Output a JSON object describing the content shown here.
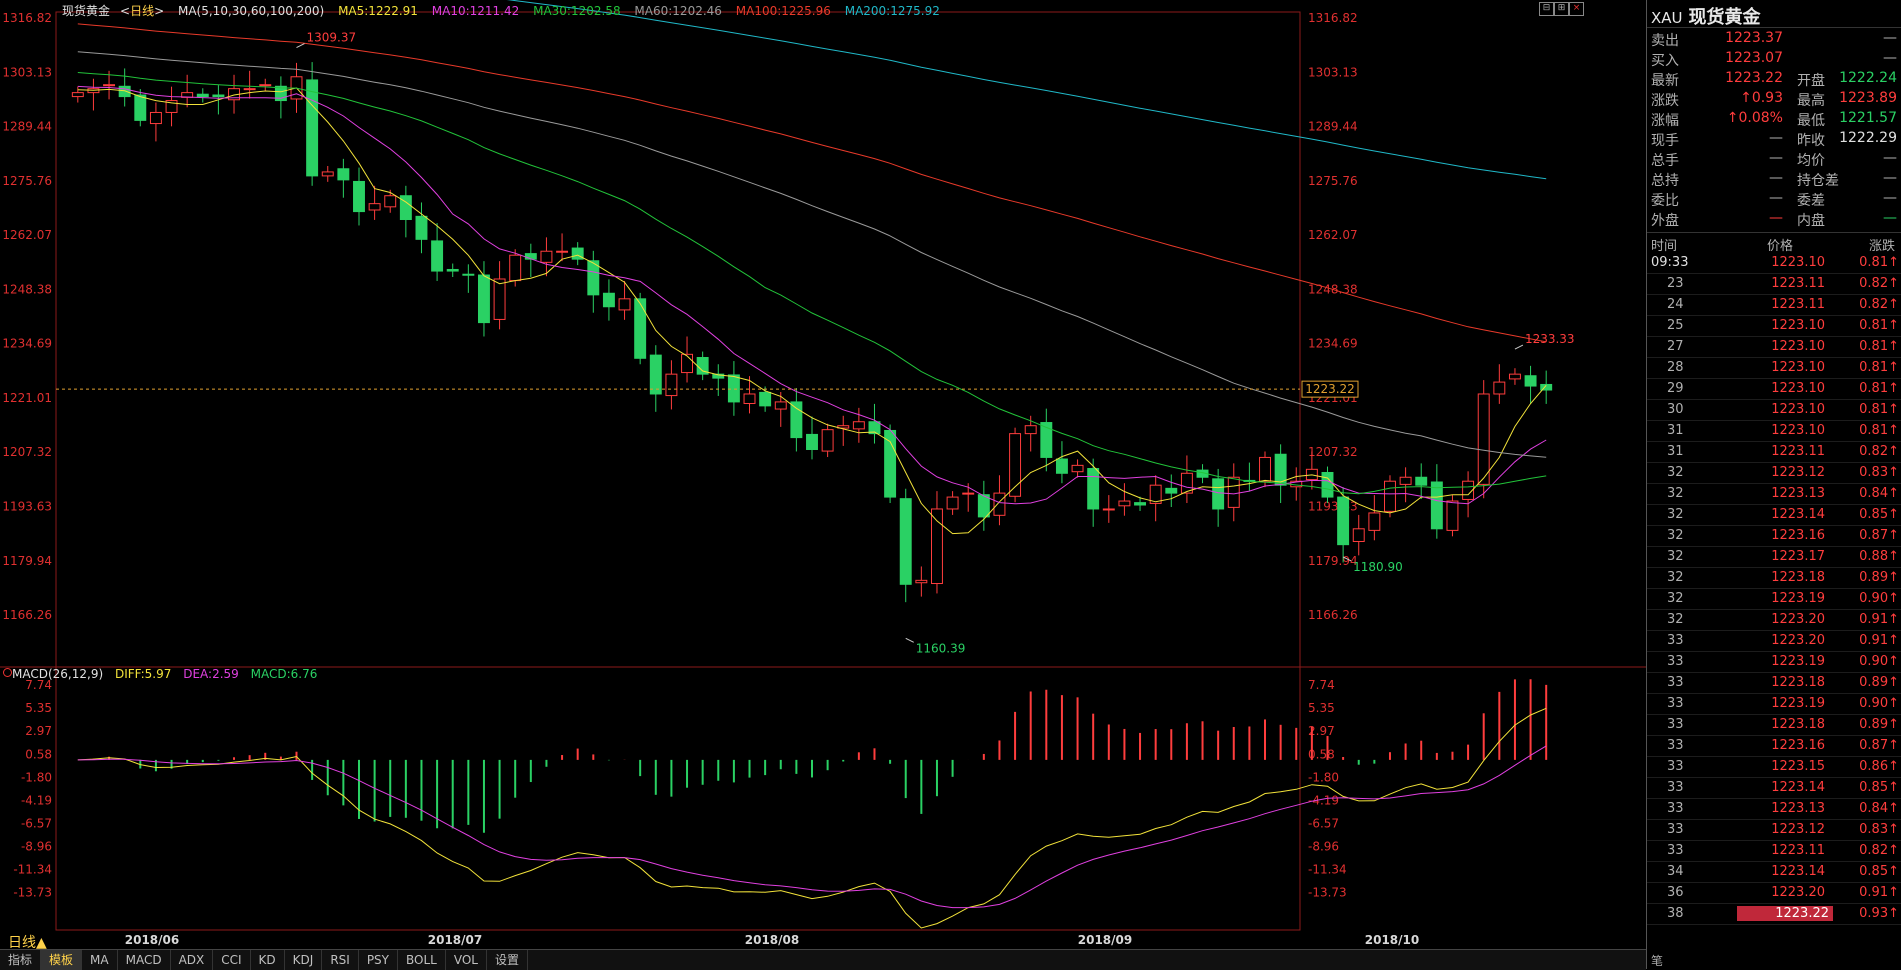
{
  "instrument": {
    "name": "现货黄金",
    "period": "日线",
    "code": "XAU"
  },
  "ma_legend": {
    "params": "MA(5,10,30,60,100,200)",
    "items": [
      {
        "label": "MA5:1222.91",
        "color": "#f2e23a"
      },
      {
        "label": "MA10:1211.42",
        "color": "#e040e0"
      },
      {
        "label": "MA30:1202.58",
        "color": "#22c33a"
      },
      {
        "label": "MA60:1202.46",
        "color": "#9a9a9a"
      },
      {
        "label": "MA100:1225.96",
        "color": "#e83a2a"
      },
      {
        "label": "MA200:1275.92",
        "color": "#20b8c8"
      }
    ]
  },
  "macd_legend": {
    "params": "MACD(26,12,9)",
    "diff": "DIFF:5.97",
    "dea": "DEA:2.59",
    "macd": "MACD:6.76"
  },
  "window_buttons": [
    "⊟",
    "⊞",
    "×"
  ],
  "current_price_tag": "1223.22",
  "chart_data": [
    {
      "type": "candlestick",
      "title": "现货黄金(日线)",
      "y_ticks": [
        "1316.82",
        "1303.13",
        "1289.44",
        "1275.76",
        "1262.07",
        "1248.38",
        "1234.69",
        "1221.01",
        "1207.32",
        "1193.63",
        "1179.94",
        "1166.26"
      ],
      "ylim": [
        1166.26,
        1316.82
      ],
      "x_labels": [
        "2018/06",
        "2018/07",
        "2018/08",
        "2018/09",
        "2018/10"
      ],
      "annotations": [
        {
          "label": "1309.37",
          "value": 1309.37
        },
        {
          "label": "1160.39",
          "value": 1160.39
        },
        {
          "label": "1180.90",
          "value": 1180.9
        },
        {
          "label": "1233.33",
          "value": 1233.33
        }
      ],
      "current_price": 1223.22,
      "closes": [
        1298,
        1299,
        1300,
        1297,
        1291,
        1293,
        1296,
        1298,
        1297,
        1297,
        1299,
        1299,
        1300,
        1296,
        1302,
        1277,
        1278,
        1276,
        1268,
        1270,
        1272,
        1266,
        1261,
        1253,
        1253,
        1252,
        1240,
        1251,
        1257,
        1256,
        1258,
        1258,
        1256,
        1247,
        1244,
        1246,
        1231,
        1222,
        1227,
        1232,
        1227,
        1226,
        1220,
        1222,
        1219,
        1220,
        1211,
        1208,
        1213,
        1214,
        1215,
        1212,
        1196,
        1174,
        1175,
        1193,
        1196,
        1197,
        1191,
        1197,
        1212,
        1214,
        1206,
        1202,
        1204,
        1193,
        1193,
        1195,
        1194,
        1199,
        1197,
        1202,
        1201,
        1193,
        1201,
        1200,
        1206,
        1199,
        1200,
        1203,
        1196,
        1184,
        1188,
        1192,
        1200,
        1201,
        1199,
        1188,
        1195,
        1200,
        1222,
        1225,
        1227,
        1224,
        1223
      ],
      "ma_series": [
        {
          "name": "MA5",
          "color": "#f2e23a"
        },
        {
          "name": "MA10",
          "color": "#e040e0"
        },
        {
          "name": "MA30",
          "color": "#22c33a"
        },
        {
          "name": "MA60",
          "color": "#9a9a9a"
        },
        {
          "name": "MA100",
          "color": "#e83a2a"
        },
        {
          "name": "MA200",
          "color": "#20b8c8"
        }
      ]
    },
    {
      "type": "macd",
      "title": "MACD(26,12,9)",
      "y_ticks": [
        "7.74",
        "5.35",
        "2.97",
        "0.58",
        "-1.80",
        "-4.19",
        "-6.57",
        "-8.96",
        "-11.34",
        "-13.73"
      ],
      "ylim": [
        -15.0,
        7.74
      ],
      "diff": 5.97,
      "dea": 2.59,
      "macd": 6.76
    }
  ],
  "quote_panel": {
    "rows": [
      {
        "l1": "卖出",
        "v1": "1223.37",
        "c1": "red",
        "l2": "",
        "v2": "—",
        "c2": "gray"
      },
      {
        "l1": "买入",
        "v1": "1223.07",
        "c1": "red",
        "l2": "",
        "v2": "—",
        "c2": "gray"
      },
      {
        "l1": "最新",
        "v1": "1223.22",
        "c1": "red",
        "l2": "开盘",
        "v2": "1222.24",
        "c2": "green"
      },
      {
        "l1": "涨跌",
        "v1": "↑0.93",
        "c1": "red",
        "l2": "最高",
        "v2": "1223.89",
        "c2": "red"
      },
      {
        "l1": "涨幅",
        "v1": "↑0.08%",
        "c1": "red",
        "l2": "最低",
        "v2": "1221.57",
        "c2": "green"
      },
      {
        "l1": "现手",
        "v1": "—",
        "c1": "gray",
        "l2": "昨收",
        "v2": "1222.29",
        "c2": "white"
      },
      {
        "l1": "总手",
        "v1": "—",
        "c1": "gray",
        "l2": "均价",
        "v2": "—",
        "c2": "gray"
      },
      {
        "l1": "总持",
        "v1": "—",
        "c1": "gray",
        "l2": "持仓差",
        "v2": "—",
        "c2": "gray"
      },
      {
        "l1": "委比",
        "v1": "—",
        "c1": "gray",
        "l2": "委差",
        "v2": "—",
        "c2": "gray"
      },
      {
        "l1": "外盘",
        "v1": "—",
        "c1": "red",
        "l2": "内盘",
        "v2": "—",
        "c2": "green"
      }
    ]
  },
  "ticks_header": {
    "time": "时间",
    "price": "价格",
    "change": "涨跌"
  },
  "ticks": [
    {
      "t": "09:33",
      "p": "1223.10",
      "c": "0.81↑"
    },
    {
      "t": "23",
      "p": "1223.11",
      "c": "0.82↑"
    },
    {
      "t": "24",
      "p": "1223.11",
      "c": "0.82↑"
    },
    {
      "t": "25",
      "p": "1223.10",
      "c": "0.81↑"
    },
    {
      "t": "27",
      "p": "1223.10",
      "c": "0.81↑"
    },
    {
      "t": "28",
      "p": "1223.10",
      "c": "0.81↑"
    },
    {
      "t": "29",
      "p": "1223.10",
      "c": "0.81↑"
    },
    {
      "t": "30",
      "p": "1223.10",
      "c": "0.81↑"
    },
    {
      "t": "31",
      "p": "1223.10",
      "c": "0.81↑"
    },
    {
      "t": "31",
      "p": "1223.11",
      "c": "0.82↑"
    },
    {
      "t": "32",
      "p": "1223.12",
      "c": "0.83↑"
    },
    {
      "t": "32",
      "p": "1223.13",
      "c": "0.84↑"
    },
    {
      "t": "32",
      "p": "1223.14",
      "c": "0.85↑"
    },
    {
      "t": "32",
      "p": "1223.16",
      "c": "0.87↑"
    },
    {
      "t": "32",
      "p": "1223.17",
      "c": "0.88↑"
    },
    {
      "t": "32",
      "p": "1223.18",
      "c": "0.89↑"
    },
    {
      "t": "32",
      "p": "1223.19",
      "c": "0.90↑"
    },
    {
      "t": "32",
      "p": "1223.20",
      "c": "0.91↑"
    },
    {
      "t": "33",
      "p": "1223.20",
      "c": "0.91↑"
    },
    {
      "t": "33",
      "p": "1223.19",
      "c": "0.90↑"
    },
    {
      "t": "33",
      "p": "1223.18",
      "c": "0.89↑"
    },
    {
      "t": "33",
      "p": "1223.19",
      "c": "0.90↑"
    },
    {
      "t": "33",
      "p": "1223.18",
      "c": "0.89↑"
    },
    {
      "t": "33",
      "p": "1223.16",
      "c": "0.87↑"
    },
    {
      "t": "33",
      "p": "1223.15",
      "c": "0.86↑"
    },
    {
      "t": "33",
      "p": "1223.14",
      "c": "0.85↑"
    },
    {
      "t": "33",
      "p": "1223.13",
      "c": "0.84↑"
    },
    {
      "t": "33",
      "p": "1223.12",
      "c": "0.83↑"
    },
    {
      "t": "33",
      "p": "1223.11",
      "c": "0.82↑"
    },
    {
      "t": "34",
      "p": "1223.14",
      "c": "0.85↑"
    },
    {
      "t": "36",
      "p": "1223.20",
      "c": "0.91↑"
    },
    {
      "t": "38",
      "p": "1223.22",
      "c": "0.93↑"
    }
  ],
  "bottom_tabs": [
    "指标",
    "模板",
    "MA",
    "MACD",
    "ADX",
    "CCI",
    "KD",
    "KDJ",
    "RSI",
    "PSY",
    "BOLL",
    "VOL",
    "设置"
  ],
  "day_tab": "日线▲",
  "panel_footer": "笔"
}
